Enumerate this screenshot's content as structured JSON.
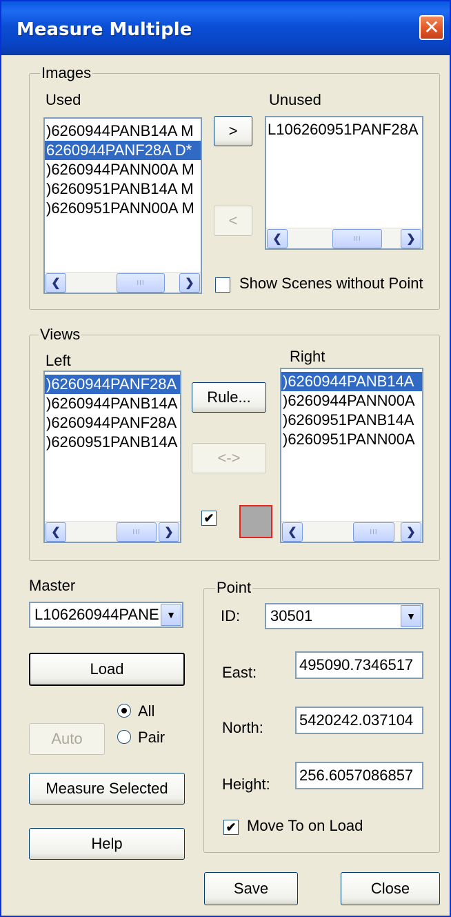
{
  "window": {
    "title": "Measure Multiple",
    "close_label": "✕"
  },
  "images": {
    "group_label": "Images",
    "used_label": "Used",
    "unused_label": "Unused",
    "used_items": [
      {
        "text": ")6260944PANB14A M",
        "selected": false
      },
      {
        "text": "6260944PANF28A D*",
        "selected": true
      },
      {
        "text": ")6260944PANN00A M",
        "selected": false
      },
      {
        "text": ")6260951PANB14A M",
        "selected": false
      },
      {
        "text": ")6260951PANN00A M",
        "selected": false
      }
    ],
    "unused_items": [
      {
        "text": "L106260951PANF28A",
        "selected": false
      }
    ],
    "move_right_label": ">",
    "move_left_label": "<",
    "show_scenes_label": "Show Scenes without Point",
    "show_scenes_checked": false
  },
  "views": {
    "group_label": "Views",
    "left_label": "Left",
    "right_label": "Right",
    "left_items": [
      {
        "text": ")6260944PANF28A",
        "selected": true
      },
      {
        "text": ")6260944PANB14A",
        "selected": false
      },
      {
        "text": ")6260944PANF28A",
        "selected": false
      },
      {
        "text": ")6260951PANB14A",
        "selected": false
      }
    ],
    "right_items": [
      {
        "text": ")6260944PANB14A",
        "selected": true
      },
      {
        "text": ")6260944PANN00A",
        "selected": false
      },
      {
        "text": ")6260951PANB14A",
        "selected": false
      },
      {
        "text": ")6260951PANN00A",
        "selected": false
      }
    ],
    "rule_label": "Rule...",
    "swap_label": "<->",
    "swatch_checked": true,
    "swatch_color": "#a9a9a9"
  },
  "master": {
    "label": "Master",
    "value": "L106260944PANE"
  },
  "buttons": {
    "load": "Load",
    "auto": "Auto",
    "measure_selected": "Measure Selected",
    "help": "Help",
    "save": "Save",
    "close": "Close"
  },
  "mode": {
    "all_label": "All",
    "pair_label": "Pair",
    "selected": "All"
  },
  "point": {
    "group_label": "Point",
    "id_label": "ID:",
    "id_value": "30501",
    "east_label": "East:",
    "east_value": "495090.7346517",
    "north_label": "North:",
    "north_value": "5420242.037104",
    "height_label": "Height:",
    "height_value": "256.6057086857",
    "move_to_label": "Move To on Load",
    "move_to_checked": true
  }
}
